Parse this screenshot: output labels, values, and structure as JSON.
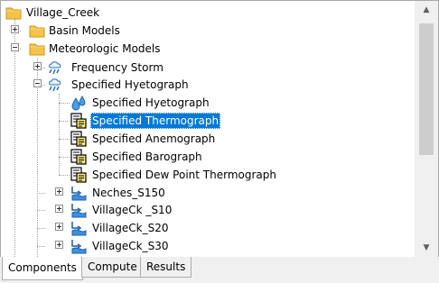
{
  "tree": {
    "root": {
      "label": "Village_Creek",
      "icon": "folder-icon"
    },
    "basin_models": {
      "label": "Basin Models",
      "icon": "folder-icon",
      "expanded": false
    },
    "meteorologic_models": {
      "label": "Meteorologic Models",
      "icon": "folder-icon",
      "expanded": true
    },
    "frequency_storm": {
      "label": "Frequency Storm",
      "icon": "storm-cloud-icon",
      "expanded": false
    },
    "specified_hyetograph": {
      "label": "Specified Hyetograph",
      "icon": "storm-cloud-icon",
      "expanded": true
    },
    "children": [
      {
        "label": "Specified Hyetograph",
        "icon": "water-drops-icon",
        "selected": false
      },
      {
        "label": "Specified Thermograph",
        "icon": "gage-sheet-icon",
        "selected": true
      },
      {
        "label": "Specified Anemograph",
        "icon": "gage-sheet-icon",
        "selected": false
      },
      {
        "label": "Specified Barograph",
        "icon": "gage-sheet-icon",
        "selected": false
      },
      {
        "label": "Specified Dew Point Thermograph",
        "icon": "gage-sheet-icon",
        "selected": false
      }
    ],
    "subbasins": [
      {
        "label": "Neches_S150",
        "icon": "subbasin-icon"
      },
      {
        "label": "VillageCk _S10",
        "icon": "subbasin-icon"
      },
      {
        "label": "VillageCk_S20",
        "icon": "subbasin-icon"
      },
      {
        "label": "VillageCk_S30",
        "icon": "subbasin-icon"
      }
    ]
  },
  "tabs": [
    {
      "label": "Components",
      "active": true
    },
    {
      "label": "Compute",
      "active": false
    },
    {
      "label": "Results",
      "active": false
    }
  ],
  "colors": {
    "selection": "#0078d7",
    "folder": "#f5c040"
  }
}
